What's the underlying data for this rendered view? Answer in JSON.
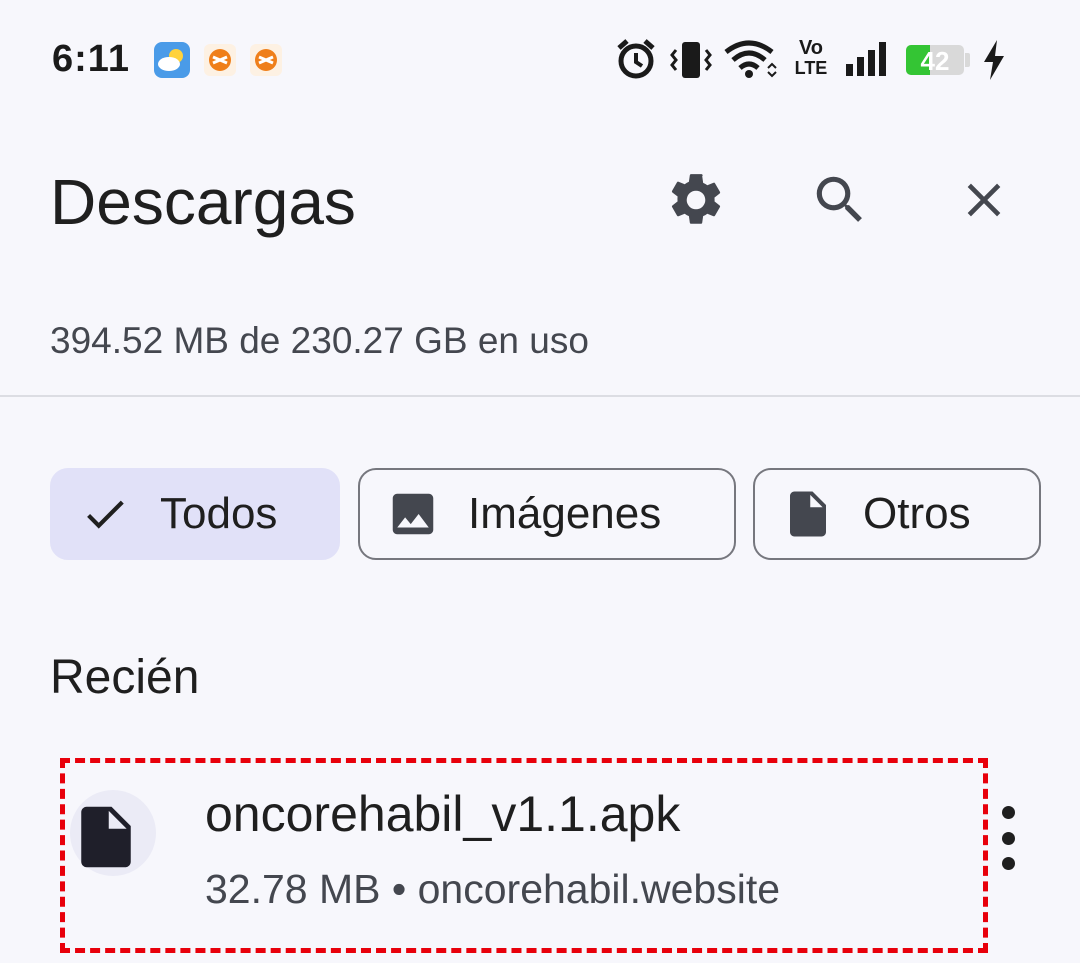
{
  "status_bar": {
    "time": "6:11",
    "notification_icons": [
      "weather-icon",
      "app-notification-icon",
      "app-notification-icon"
    ],
    "system_icons": [
      "alarm-icon",
      "vibrate-icon",
      "wifi-icon",
      "volte-icon",
      "signal-icon"
    ],
    "volte_top": "Vo",
    "volte_bottom": "LTE",
    "battery_level": "42",
    "battery_fraction": 0.42,
    "charging": true,
    "battery_color": "#34c534"
  },
  "header": {
    "title": "Descargas",
    "actions": [
      "gear-icon",
      "search-icon",
      "close-icon"
    ]
  },
  "storage": {
    "usage_text": "394.52 MB de 230.27 GB en uso"
  },
  "filters": {
    "chips": [
      {
        "label": "Todos",
        "icon": "check-icon",
        "selected": true
      },
      {
        "label": "Imágenes",
        "icon": "image-icon",
        "selected": false
      },
      {
        "label": "Otros",
        "icon": "file-icon",
        "selected": false
      }
    ],
    "selected_color": "#e1e1f8"
  },
  "recent": {
    "section_label": "Recién",
    "items": [
      {
        "filename": "oncorehabil_v1.1.apk",
        "meta": "32.78 MB • oncorehabil.website",
        "icon": "file-icon"
      }
    ]
  },
  "highlight_color": "#e8000b"
}
